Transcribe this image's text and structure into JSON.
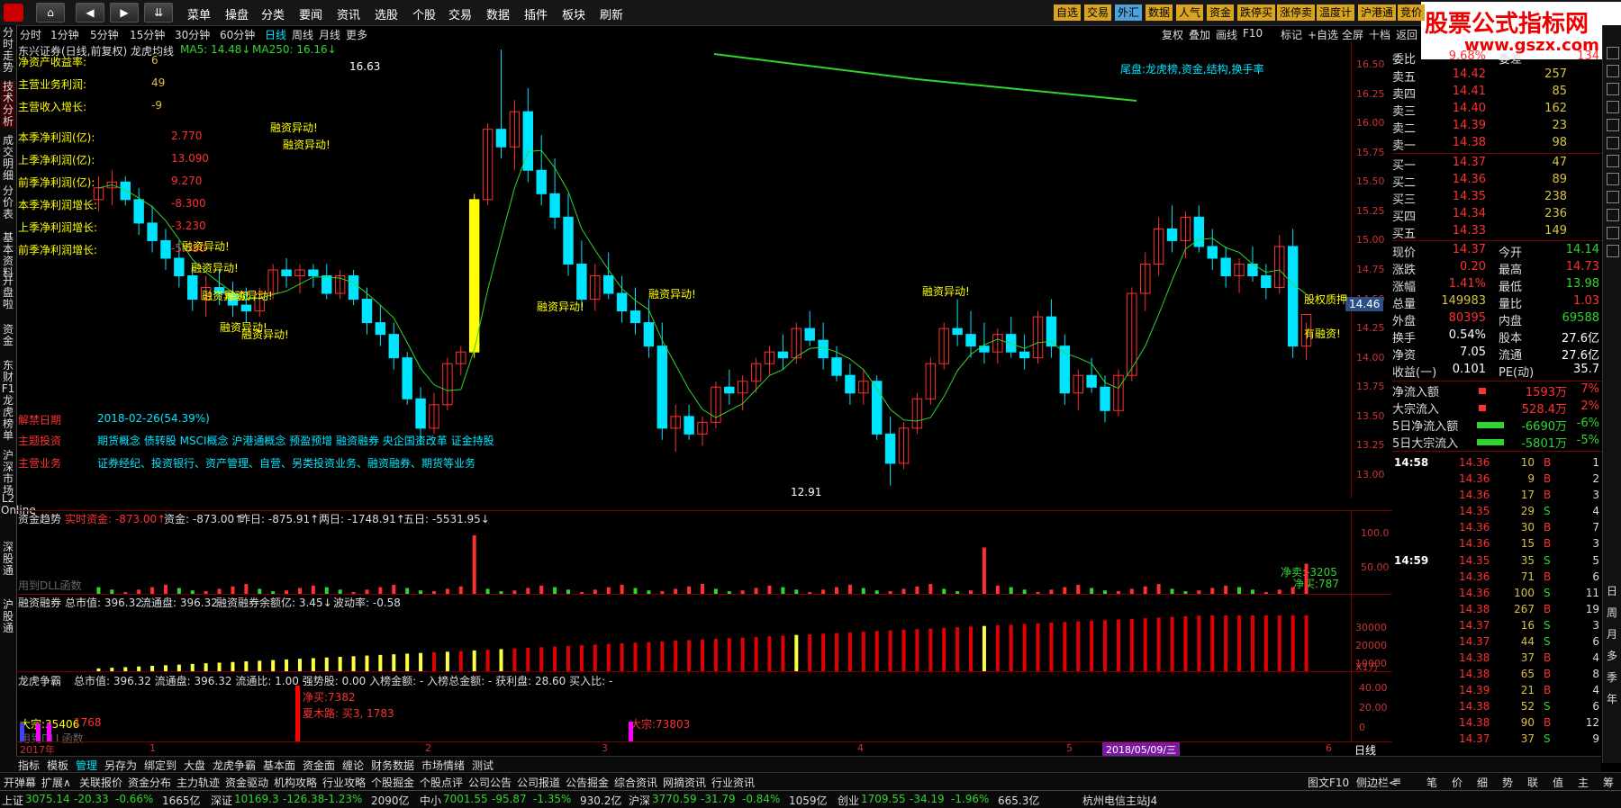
{
  "menu": [
    "菜单",
    "操盘",
    "分类",
    "要闻",
    "资讯",
    "选股",
    "个股",
    "交易",
    "数据",
    "插件",
    "板块",
    "刷新"
  ],
  "top_tags": [
    {
      "label": "自选",
      "color": "#d9a521"
    },
    {
      "label": "交易",
      "color": "#d9a521"
    },
    {
      "label": "外汇",
      "color": "#4fa3d9"
    },
    {
      "label": "数据",
      "color": "#d9a521"
    },
    {
      "label": "人气",
      "color": "#d9a521"
    },
    {
      "label": "资金",
      "color": "#d9a521"
    },
    {
      "label": "跌停买",
      "color": "#d9a521"
    },
    {
      "label": "涨停卖",
      "color": "#d9a521"
    },
    {
      "label": "温度计",
      "color": "#d9a521"
    },
    {
      "label": "沪港通",
      "color": "#d9a521"
    },
    {
      "label": "竞价",
      "color": "#d9a521"
    }
  ],
  "watermark": {
    "title": "股票公式指标网",
    "url": "www.gszx.com"
  },
  "periods": [
    "分时",
    "1分钟",
    "5分钟",
    "15分钟",
    "30分钟",
    "60分钟",
    "日线",
    "周线",
    "月线",
    "更多"
  ],
  "active_period": "日线",
  "chart_tools": [
    "复权",
    "叠加",
    "画线",
    "F10",
    "标记",
    "+自选",
    "全屏",
    "十档",
    "返回"
  ],
  "left_tabs": [
    "分时走势",
    "技术分析",
    "成交明细",
    "分价表",
    "基本资料",
    "开盘啦",
    "资金",
    "东财F1 龙虎榜单",
    "沪深市场",
    "L2 Online",
    "深股通",
    "沪股通"
  ],
  "main_title": "东兴证券(日线,前复权) 龙虎均线",
  "ma": {
    "ma5": "MA5: 14.48↓",
    "ma250": "MA250: 16.16↓"
  },
  "tail_note": "尾盘:龙虎榜,资金,结构,换手率",
  "fundamentals": [
    {
      "label": "净资产收益率:",
      "value": "6",
      "color": "#d9c240"
    },
    {
      "label": "主营业务利润:",
      "value": "49",
      "color": "#d9c240"
    },
    {
      "label": "主营收入增长:",
      "value": "-9",
      "color": "#d9c240"
    },
    {
      "label": "本季净利润(亿):",
      "value": "2.770",
      "color": "#ff3030"
    },
    {
      "label": "上季净利润(亿):",
      "value": "13.090",
      "color": "#ff3030"
    },
    {
      "label": "前季净利润(亿):",
      "value": "9.270",
      "color": "#ff3030"
    },
    {
      "label": "本季净利润增长:",
      "value": "-8.300",
      "color": "#ff3030"
    },
    {
      "label": "上季净利润增长:",
      "value": "-3.230",
      "color": "#ff3030"
    },
    {
      "label": "前季净利润增长:",
      "value": "-5.580",
      "color": "#ff3030"
    }
  ],
  "unlock": {
    "label": "解禁日期",
    "value": "2018-02-26(54.39%)"
  },
  "themes": {
    "label": "主题投资",
    "value": "期货概念 债转股 MSCI概念 沪港通概念 预盈预增 融资融券 央企国资改革 证金持股"
  },
  "business": {
    "label": "主营业务",
    "value": "证券经纪、投资银行、资产管理、自营、另类投资业务、融资融券、期货等业务"
  },
  "price_labels": {
    "high": "16.63",
    "low": "12.91",
    "current": "14.46",
    "pledge": "股权质押",
    "margin": "有融资!"
  },
  "events": [
    "融资异动!",
    "融资异动!",
    "融资异动!",
    "融资异动!",
    "融资异动!",
    "融资异动!",
    "融资异动!",
    "融资异动!",
    "融资异动!",
    "融资异动!",
    "融资异动!"
  ],
  "y_axis": [
    "16.50",
    "16.25",
    "16.00",
    "15.75",
    "15.50",
    "15.25",
    "15.00",
    "14.75",
    "14.50",
    "14.25",
    "14.00",
    "13.75",
    "13.50",
    "13.25",
    "13.00"
  ],
  "fund_panel": {
    "title": "资金趋势",
    "realtime": "实时资金: -873.00↑",
    "fund": "资金: -873.00↑",
    "yesterday": "昨日: -875.91↑",
    "two_day": "两日: -1748.91↑",
    "five_day": "五日: -5531.95↓",
    "dll": "用到DLL函数",
    "net_sell": "净卖:-3205",
    "net_buy": "净买:787",
    "axis": [
      "100.0",
      "50.00"
    ]
  },
  "margin_panel": {
    "title": "融资融券",
    "market_cap": "总市值: 396.32",
    "float_cap": "流通盘: 396.32",
    "balance": "融资融券余额亿: 3.45↓",
    "volatility": "波动率: -0.58",
    "axis": [
      "30000",
      "20000",
      "10000"
    ],
    "unit": "X1万"
  },
  "lhb_panel": {
    "title": "龙虎争霸",
    "text": "总市值: 396.32 流通盘: 396.32 流通比: 1.00 强势股: 0.00 入榜金额: - 入榜总金额: - 获利盘: 28.60 买入比: -",
    "net_buy": "净买:7382",
    "xia_mo_lu": "夏木路: 买3, 1783",
    "da_zong1": "大宗:73803",
    "da_zong0": "大宗:35406",
    "da_zong0b": "1768",
    "dll": "用到DLL函数",
    "axis": [
      "40.00",
      "20.00",
      "0"
    ]
  },
  "x_axis": {
    "labels": [
      "2017年",
      "1",
      "2",
      "3",
      "4",
      "5",
      "6"
    ],
    "date_hl": "2018/05/09/三",
    "period": "日线"
  },
  "quote": {
    "commission": {
      "label": "委比",
      "value": "9.68%",
      "label2": "委差",
      "value2": "134"
    },
    "asks": [
      {
        "name": "卖五",
        "price": "14.42",
        "vol": "257"
      },
      {
        "name": "卖四",
        "price": "14.41",
        "vol": "85"
      },
      {
        "name": "卖三",
        "price": "14.40",
        "vol": "162"
      },
      {
        "name": "卖二",
        "price": "14.39",
        "vol": "23"
      },
      {
        "name": "卖一",
        "price": "14.38",
        "vol": "98"
      }
    ],
    "bids": [
      {
        "name": "买一",
        "price": "14.37",
        "vol": "47"
      },
      {
        "name": "买二",
        "price": "14.36",
        "vol": "89"
      },
      {
        "name": "买三",
        "price": "14.35",
        "vol": "238"
      },
      {
        "name": "买四",
        "price": "14.34",
        "vol": "236"
      },
      {
        "name": "买五",
        "price": "14.33",
        "vol": "149"
      }
    ],
    "stats": [
      {
        "l1": "现价",
        "v1": "14.37",
        "c1": "#ff3030",
        "l2": "今开",
        "v2": "14.14",
        "c2": "#2fd62f"
      },
      {
        "l1": "涨跌",
        "v1": "0.20",
        "c1": "#ff3030",
        "l2": "最高",
        "v2": "14.73",
        "c2": "#ff3030"
      },
      {
        "l1": "涨幅",
        "v1": "1.41%",
        "c1": "#ff3030",
        "l2": "最低",
        "v2": "13.98",
        "c2": "#2fd62f"
      },
      {
        "l1": "总量",
        "v1": "149983",
        "c1": "#d9c240",
        "l2": "量比",
        "v2": "1.03",
        "c2": "#ff3030"
      },
      {
        "l1": "外盘",
        "v1": "80395",
        "c1": "#ff3030",
        "l2": "内盘",
        "v2": "69588",
        "c2": "#2fd62f"
      },
      {
        "l1": "换手",
        "v1": "0.54%",
        "c1": "#fff",
        "l2": "股本",
        "v2": "27.6亿",
        "c2": "#fff"
      },
      {
        "l1": "净资",
        "v1": "7.05",
        "c1": "#fff",
        "l2": "流通",
        "v2": "27.6亿",
        "c2": "#fff"
      },
      {
        "l1": "收益(一)",
        "v1": "0.101",
        "c1": "#fff",
        "l2": "PE(动)",
        "v2": "35.7",
        "c2": "#fff"
      }
    ],
    "flows": [
      {
        "label": "净流入额",
        "value": "1593万",
        "pct": "7%",
        "color": "#ff3030",
        "bar": "red"
      },
      {
        "label": "大宗流入",
        "value": "528.4万",
        "pct": "2%",
        "color": "#ff3030",
        "bar": "red"
      },
      {
        "label": "5日净流入额",
        "value": "-6690万",
        "pct": "-6%",
        "color": "#2fd62f",
        "bar": "green"
      },
      {
        "label": "5日大宗流入",
        "value": "-5801万",
        "pct": "-5%",
        "color": "#2fd62f",
        "bar": "green"
      }
    ],
    "ticks_1458": [
      {
        "price": "14.36",
        "vol": "10",
        "bs": "B",
        "n": "1"
      },
      {
        "price": "14.36",
        "vol": "9",
        "bs": "B",
        "n": "2"
      },
      {
        "price": "14.36",
        "vol": "17",
        "bs": "B",
        "n": "3"
      },
      {
        "price": "14.35",
        "vol": "29",
        "bs": "S",
        "n": "4"
      },
      {
        "price": "14.36",
        "vol": "30",
        "bs": "B",
        "n": "7"
      },
      {
        "price": "14.36",
        "vol": "15",
        "bs": "B",
        "n": "3"
      }
    ],
    "ticks_1459": [
      {
        "price": "14.35",
        "vol": "35",
        "bs": "S",
        "n": "5"
      },
      {
        "price": "14.36",
        "vol": "71",
        "bs": "B",
        "n": "6"
      },
      {
        "price": "14.36",
        "vol": "100",
        "bs": "S",
        "n": "11"
      },
      {
        "price": "14.38",
        "vol": "267",
        "bs": "B",
        "n": "19"
      },
      {
        "price": "14.37",
        "vol": "16",
        "bs": "S",
        "n": "3"
      },
      {
        "price": "14.37",
        "vol": "44",
        "bs": "S",
        "n": "6"
      },
      {
        "price": "14.38",
        "vol": "37",
        "bs": "B",
        "n": "4"
      },
      {
        "price": "14.38",
        "vol": "65",
        "bs": "B",
        "n": "8"
      },
      {
        "price": "14.39",
        "vol": "21",
        "bs": "B",
        "n": "4"
      },
      {
        "price": "14.38",
        "vol": "52",
        "bs": "S",
        "n": "6"
      },
      {
        "price": "14.38",
        "vol": "90",
        "bs": "B",
        "n": "12"
      },
      {
        "price": "14.37",
        "vol": "37",
        "bs": "S",
        "n": "9"
      }
    ],
    "time_1458": "14:58",
    "time_1459": "14:59"
  },
  "right_bottom_tabs": [
    "笔",
    "价",
    "细",
    "势",
    "联",
    "值",
    "主",
    "筹"
  ],
  "right_vertical": [
    "日",
    "周",
    "月",
    "多",
    "季",
    "年"
  ],
  "bottom_tabs": [
    "指标",
    "模板",
    "管理",
    "另存为",
    "绑定到",
    "大盘",
    "龙虎争霸",
    "基本面",
    "资金面",
    "缠论",
    "财务数据",
    "市场情绪",
    "测试"
  ],
  "bottom_row2": [
    "开弹幕",
    "扩展∧",
    "关联报价",
    "资金分布",
    "主力轨迹",
    "资金驱动",
    "机构攻略",
    "行业攻略",
    "个股掘金",
    "个股点评",
    "公司公告",
    "公司报道",
    "公告掘金",
    "综合资讯",
    "网摘资讯",
    "行业资讯"
  ],
  "bottom_right": [
    "图文F10",
    "侧边栏<",
    "≡"
  ],
  "status": [
    {
      "label": "上证",
      "value": "3075.14",
      "chg": "-20.33",
      "pct": "-0.66%",
      "amt": "1665亿"
    },
    {
      "label": "深证",
      "value": "10169.3",
      "chg": "-126.38",
      "pct": "-1.23%",
      "amt": "2090亿"
    },
    {
      "label": "中小",
      "value": "7001.55",
      "chg": "-95.87",
      "pct": "-1.35%",
      "amt": "930.2亿"
    },
    {
      "label": "沪深",
      "value": "3770.59",
      "chg": "-31.79",
      "pct": "-0.84%",
      "amt": "1059亿"
    },
    {
      "label": "创业",
      "value": "1709.55",
      "chg": "-34.19",
      "pct": "-1.96%",
      "amt": "665.3亿"
    }
  ],
  "server": "杭州电信主站J4",
  "colors": {
    "up": "#ff3030",
    "down": "#00e5ff",
    "yellow": "#ffff00",
    "ma": "#2fd62f",
    "ma250": "#2fd62f"
  },
  "chart_data": {
    "type": "candlestick",
    "title": "东兴证券(日线,前复权) 龙虎均线",
    "ylim": [
      12.8,
      16.7
    ],
    "series": [
      {
        "name": "MA5",
        "values": []
      },
      {
        "name": "MA250",
        "values": []
      }
    ],
    "candles": [
      [
        15.35,
        15.55,
        15.25,
        15.45
      ],
      [
        15.45,
        15.6,
        15.3,
        15.5
      ],
      [
        15.5,
        15.55,
        15.3,
        15.35
      ],
      [
        15.35,
        15.45,
        15.05,
        15.15
      ],
      [
        15.15,
        15.3,
        14.9,
        15.0
      ],
      [
        15.0,
        15.1,
        14.75,
        14.85
      ],
      [
        14.85,
        15.0,
        14.6,
        14.7
      ],
      [
        14.7,
        14.8,
        14.4,
        14.5
      ],
      [
        14.5,
        14.7,
        14.35,
        14.6
      ],
      [
        14.6,
        14.75,
        14.45,
        14.55
      ],
      [
        14.55,
        14.65,
        14.35,
        14.45
      ],
      [
        14.45,
        14.6,
        14.3,
        14.4
      ],
      [
        14.4,
        14.6,
        14.35,
        14.55
      ],
      [
        14.55,
        14.8,
        14.5,
        14.75
      ],
      [
        14.75,
        14.85,
        14.6,
        14.7
      ],
      [
        14.7,
        14.8,
        14.55,
        14.75
      ],
      [
        14.75,
        14.8,
        14.6,
        14.7
      ],
      [
        14.7,
        14.8,
        14.5,
        14.55
      ],
      [
        14.55,
        14.75,
        14.5,
        14.7
      ],
      [
        14.7,
        14.75,
        14.45,
        14.5
      ],
      [
        14.5,
        14.6,
        14.2,
        14.3
      ],
      [
        14.3,
        14.45,
        14.1,
        14.2
      ],
      [
        14.2,
        14.3,
        13.9,
        14.0
      ],
      [
        14.0,
        14.05,
        13.6,
        13.65
      ],
      [
        13.65,
        13.75,
        13.25,
        13.4
      ],
      [
        13.4,
        13.7,
        13.35,
        13.6
      ],
      [
        13.6,
        14.0,
        13.55,
        13.95
      ],
      [
        13.95,
        14.1,
        13.85,
        14.05
      ],
      [
        14.05,
        15.4,
        14.0,
        15.35
      ],
      [
        15.35,
        16.0,
        15.3,
        15.95
      ],
      [
        15.95,
        16.63,
        15.7,
        15.8
      ],
      [
        15.8,
        16.2,
        15.6,
        16.1
      ],
      [
        16.1,
        16.3,
        15.5,
        15.6
      ],
      [
        15.6,
        15.9,
        15.3,
        15.4
      ],
      [
        15.4,
        15.7,
        15.1,
        15.2
      ],
      [
        15.2,
        15.4,
        14.7,
        14.8
      ],
      [
        14.8,
        15.0,
        14.4,
        14.5
      ],
      [
        14.5,
        14.8,
        14.4,
        14.7
      ],
      [
        14.7,
        14.9,
        14.5,
        14.55
      ],
      [
        14.55,
        14.7,
        14.3,
        14.4
      ],
      [
        14.4,
        14.6,
        14.2,
        14.3
      ],
      [
        14.3,
        14.5,
        14.0,
        14.1
      ],
      [
        14.1,
        14.3,
        13.3,
        13.4
      ],
      [
        13.4,
        13.6,
        13.2,
        13.5
      ],
      [
        13.5,
        13.6,
        13.3,
        13.35
      ],
      [
        13.35,
        13.5,
        13.25,
        13.45
      ],
      [
        13.45,
        13.8,
        13.4,
        13.75
      ],
      [
        13.75,
        13.9,
        13.6,
        13.7
      ],
      [
        13.7,
        13.85,
        13.55,
        13.8
      ],
      [
        13.8,
        14.0,
        13.7,
        13.95
      ],
      [
        13.95,
        14.1,
        13.85,
        14.05
      ],
      [
        14.05,
        14.2,
        13.9,
        14.0
      ],
      [
        14.0,
        14.3,
        13.95,
        14.25
      ],
      [
        14.25,
        14.4,
        14.1,
        14.15
      ],
      [
        14.15,
        14.3,
        13.9,
        14.0
      ],
      [
        14.0,
        14.1,
        13.8,
        13.85
      ],
      [
        13.85,
        13.95,
        13.6,
        13.7
      ],
      [
        13.7,
        13.9,
        13.6,
        13.8
      ],
      [
        13.8,
        13.85,
        13.3,
        13.35
      ],
      [
        13.35,
        13.5,
        12.91,
        13.1
      ],
      [
        13.1,
        13.45,
        13.05,
        13.4
      ],
      [
        13.4,
        13.7,
        13.35,
        13.65
      ],
      [
        13.65,
        14.0,
        13.6,
        13.95
      ],
      [
        13.95,
        14.3,
        13.9,
        14.25
      ],
      [
        14.25,
        14.5,
        14.1,
        14.2
      ],
      [
        14.2,
        14.4,
        14.0,
        14.1
      ],
      [
        14.1,
        14.3,
        13.95,
        14.05
      ],
      [
        14.05,
        14.25,
        13.95,
        14.2
      ],
      [
        14.2,
        14.35,
        14.0,
        14.05
      ],
      [
        14.05,
        14.2,
        13.9,
        14.0
      ],
      [
        14.0,
        14.4,
        13.95,
        14.35
      ],
      [
        14.35,
        14.5,
        14.0,
        14.1
      ],
      [
        14.1,
        14.2,
        13.6,
        13.7
      ],
      [
        13.7,
        13.9,
        13.55,
        13.85
      ],
      [
        13.85,
        14.0,
        13.7,
        13.75
      ],
      [
        13.75,
        13.85,
        13.45,
        13.55
      ],
      [
        13.55,
        13.9,
        13.5,
        13.85
      ],
      [
        13.85,
        14.6,
        13.8,
        14.55
      ],
      [
        14.55,
        14.9,
        14.4,
        14.8
      ],
      [
        14.8,
        15.2,
        14.7,
        15.1
      ],
      [
        15.1,
        15.3,
        14.9,
        15.0
      ],
      [
        15.0,
        15.25,
        14.85,
        15.2
      ],
      [
        15.2,
        15.3,
        14.9,
        14.95
      ],
      [
        14.95,
        15.1,
        14.75,
        14.85
      ],
      [
        14.85,
        14.95,
        14.6,
        14.7
      ],
      [
        14.7,
        14.85,
        14.55,
        14.8
      ],
      [
        14.8,
        14.95,
        14.65,
        14.7
      ],
      [
        14.7,
        14.8,
        14.5,
        14.6
      ],
      [
        14.6,
        15.05,
        14.55,
        14.95
      ],
      [
        14.95,
        15.1,
        14.0,
        14.1
      ],
      [
        14.1,
        14.3,
        13.98,
        14.37
      ]
    ]
  }
}
